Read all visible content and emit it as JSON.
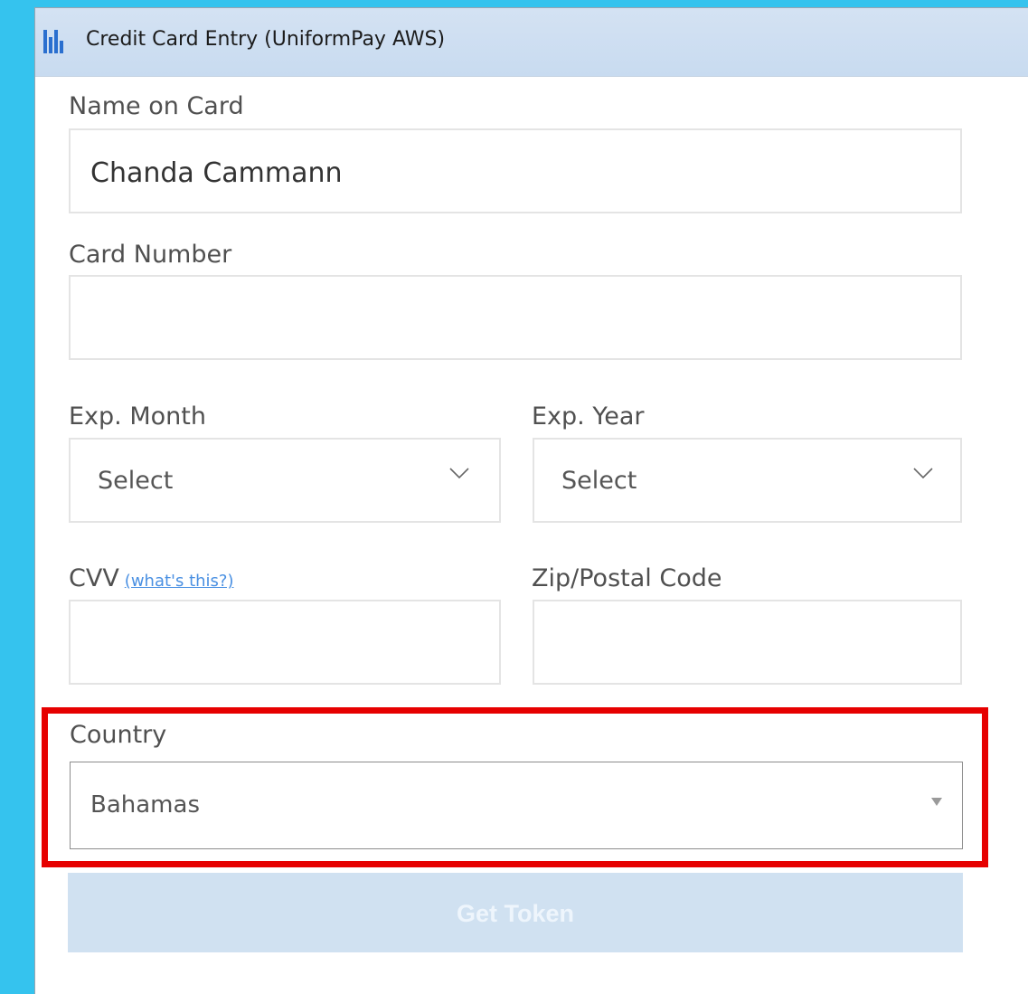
{
  "window": {
    "title": "Credit Card Entry (UniformPay AWS)",
    "app_icon": "uniformpay-icon"
  },
  "form": {
    "name_on_card": {
      "label": "Name on Card",
      "value": "Chanda Cammann"
    },
    "card_number": {
      "label": "Card Number",
      "value": ""
    },
    "exp_month": {
      "label": "Exp. Month",
      "value": "Select",
      "icon": "chevron-down-icon"
    },
    "exp_year": {
      "label": "Exp. Year",
      "value": "Select",
      "icon": "chevron-down-icon"
    },
    "cvv": {
      "label": "CVV",
      "help_link": "(what's this?)",
      "value": ""
    },
    "zip": {
      "label": "Zip/Postal Code",
      "value": ""
    },
    "country": {
      "label": "Country",
      "value": "Bahamas",
      "icon": "dropdown-arrow-icon"
    },
    "submit_label": "Get Token"
  },
  "colors": {
    "desktop_background": "#35c3ee",
    "highlight_border": "#e60000",
    "button_disabled": "#d0e1f1",
    "link": "#4a90e2"
  }
}
